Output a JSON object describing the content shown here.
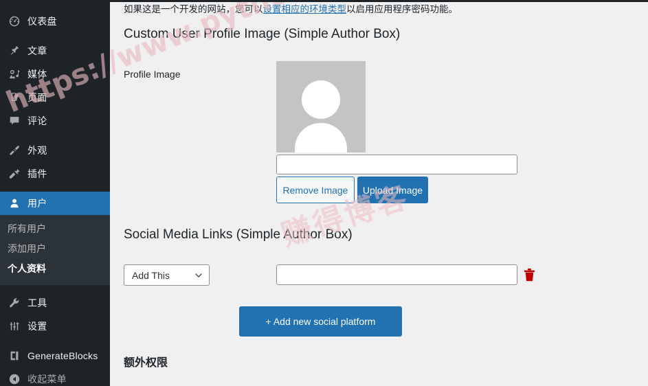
{
  "sidebar": {
    "items": [
      {
        "icon": "dashboard-icon",
        "label": "仪表盘",
        "state": "normal",
        "name": "sidebar-item-dashboard"
      },
      {
        "icon": "pin-icon",
        "label": "文章",
        "state": "normal",
        "name": "sidebar-item-posts"
      },
      {
        "icon": "media-icon",
        "label": "媒体",
        "state": "normal",
        "name": "sidebar-item-media"
      },
      {
        "icon": "page-icon",
        "label": "页面",
        "state": "normal",
        "name": "sidebar-item-pages"
      },
      {
        "icon": "comment-icon",
        "label": "评论",
        "state": "normal",
        "name": "sidebar-item-comments"
      },
      {
        "icon": "appearance-icon",
        "label": "外观",
        "state": "normal",
        "name": "sidebar-item-appearance"
      },
      {
        "icon": "plugin-icon",
        "label": "插件",
        "state": "normal",
        "name": "sidebar-item-plugins"
      },
      {
        "icon": "user-icon",
        "label": "用户",
        "state": "current",
        "name": "sidebar-item-users"
      },
      {
        "icon": "tools-icon",
        "label": "工具",
        "state": "normal",
        "name": "sidebar-item-tools"
      },
      {
        "icon": "settings-icon",
        "label": "设置",
        "state": "normal",
        "name": "sidebar-item-settings"
      },
      {
        "icon": "generateblocks-icon",
        "label": "GenerateBlocks",
        "state": "normal",
        "name": "sidebar-item-generateblocks"
      },
      {
        "icon": "collapse-icon",
        "label": "收起菜单",
        "state": "dim",
        "name": "sidebar-item-collapse"
      }
    ],
    "submenu": [
      {
        "label": "所有用户",
        "current": false
      },
      {
        "label": "添加用户",
        "current": false
      },
      {
        "label": "个人资料",
        "current": true
      }
    ],
    "colors": {
      "background": "#1d2327",
      "submenu_background": "#2c3338",
      "current_background": "#2271b1",
      "text": "#f0f0f1"
    }
  },
  "notice": {
    "text_before": "如果这是一个开发的网站，您可以",
    "link_text": "设置相应的环境类型",
    "text_after": "以启用应用程序密码功能。",
    "link_color": "#2271b1"
  },
  "profile_image_section": {
    "heading": "Custom User Profile Image (Simple Author Box)",
    "field_label": "Profile Image",
    "avatar_alt": "default-avatar-placeholder",
    "avatar_bg": "#c4c4c4",
    "image_url_value": "",
    "image_url_placeholder": "",
    "remove_button": "Remove Image",
    "upload_button": "Upload Image",
    "button_accent": "#2271b1"
  },
  "social_section": {
    "heading": "Social Media Links (Simple Author Box)",
    "select_value": "Add This",
    "select_options": [
      "Add This"
    ],
    "url_value": "",
    "url_placeholder": "",
    "delete_icon_label": "trash-icon",
    "delete_icon_color": "#c00000",
    "add_button": "+ Add new social platform"
  },
  "extra_section": {
    "heading": "额外权限"
  },
  "watermarks": {
    "url": "https://www.pythonthree.com",
    "chinese": "赚得博客"
  }
}
